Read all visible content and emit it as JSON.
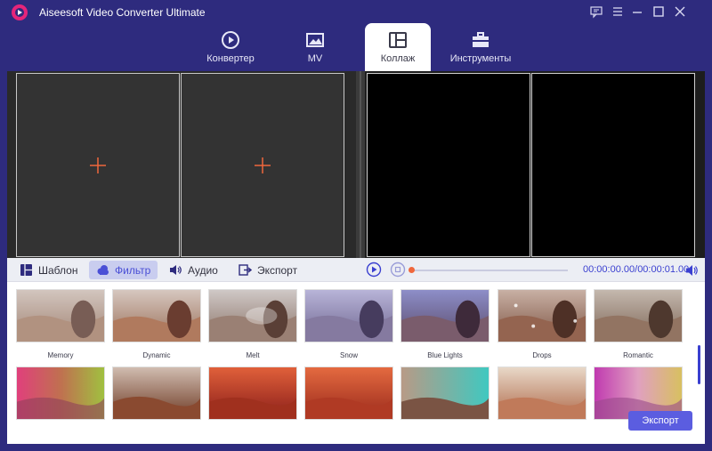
{
  "app": {
    "title": "Aiseesoft Video Converter Ultimate"
  },
  "nav": {
    "tabs": [
      {
        "label": "Конвертер",
        "icon": "refresh-circle-icon"
      },
      {
        "label": "MV",
        "icon": "image-icon"
      },
      {
        "label": "Коллаж",
        "icon": "collage-icon",
        "active": true
      },
      {
        "label": "Инструменты",
        "icon": "toolbox-icon"
      }
    ]
  },
  "panel_tabs": [
    {
      "label": "Шаблон",
      "icon": "template-icon"
    },
    {
      "label": "Фильтр",
      "icon": "cloud-icon",
      "active": true
    },
    {
      "label": "Аудио",
      "icon": "speaker-icon"
    },
    {
      "label": "Экспорт",
      "icon": "export-icon"
    }
  ],
  "player": {
    "current_time": "00:00:00.00",
    "separator": "/",
    "total_time": "00:00:01.00"
  },
  "filters": {
    "row1": [
      "Memory",
      "Dynamic",
      "Melt",
      "Snow",
      "Blue Lights",
      "Drops",
      "Romantic"
    ],
    "row2": [
      "",
      "",
      "",
      "",
      "",
      "",
      ""
    ]
  },
  "export_button": "Экспорт",
  "colors": {
    "brand": "#2e2b7e",
    "accent": "#5b5de0",
    "plus": "#f0673c"
  }
}
